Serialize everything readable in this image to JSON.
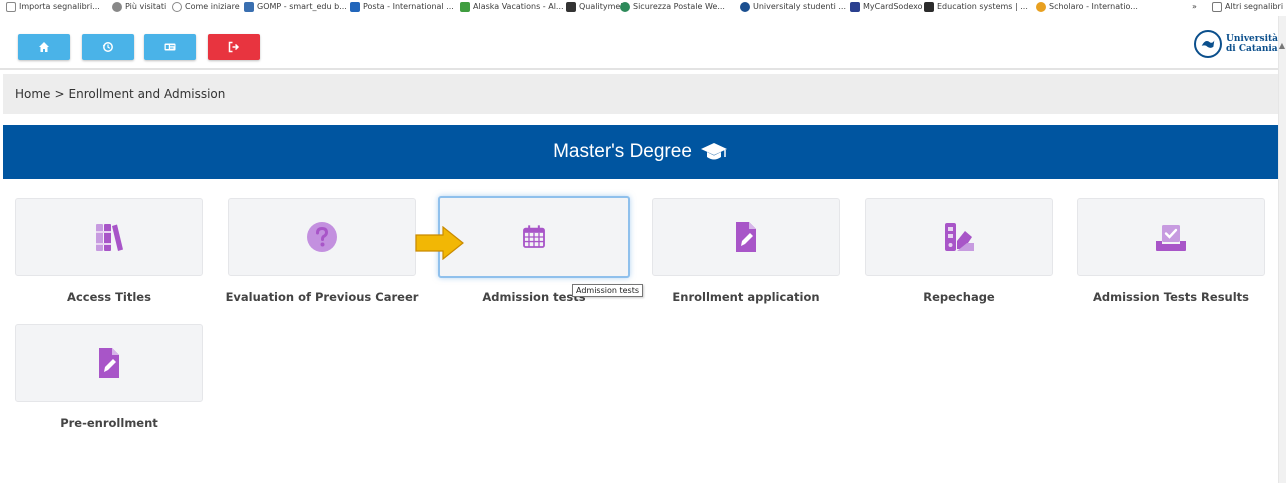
{
  "bookmarks": [
    {
      "label": "Importa segnalibri...",
      "color": "#7a7a7a"
    },
    {
      "label": "Più visitati",
      "color": "#6e6e6e"
    },
    {
      "label": "Come iniziare",
      "color": "#8a8a8a"
    },
    {
      "label": "GOMP - smart_edu b...",
      "color": "#3a6fb0"
    },
    {
      "label": "Posta - International ...",
      "color": "#2266bb"
    },
    {
      "label": "Alaska Vacations - Al...",
      "color": "#3f9d3f"
    },
    {
      "label": "Qualitymei",
      "color": "#333333"
    },
    {
      "label": "Sicurezza Postale We...",
      "color": "#2d8a5a"
    },
    {
      "label": "Universitaly studenti ...",
      "color": "#1a4e8f"
    },
    {
      "label": "MyCardSodexo",
      "color": "#2a3f8f"
    },
    {
      "label": "Education systems | ...",
      "color": "#2b2b2b"
    },
    {
      "label": "Scholaro - Internatio...",
      "color": "#e8a020"
    }
  ],
  "bookmarks_more": "»",
  "bookmarks_other": "Altri segnalibri",
  "toolbar": {
    "buttons": [
      {
        "name": "home-button",
        "icon": "home-icon",
        "color": "#4ab3e8"
      },
      {
        "name": "history-button",
        "icon": "history-icon",
        "color": "#4ab3e8"
      },
      {
        "name": "id-card-button",
        "icon": "id-card-icon",
        "color": "#4ab3e8"
      },
      {
        "name": "logout-button",
        "icon": "logout-icon",
        "color": "#e8343f"
      }
    ],
    "logo_line1": "Università",
    "logo_line2": "di Catania"
  },
  "breadcrumb": {
    "home": "Home",
    "separator": ">",
    "current": "Enrollment and Admission"
  },
  "banner": {
    "title": "Master's Degree",
    "color": "#0055a0"
  },
  "tiles": [
    {
      "label": "Access Titles",
      "icon": "books-icon"
    },
    {
      "label": "Evaluation of Previous Career",
      "icon": "question-circle-icon"
    },
    {
      "label": "Admission tests",
      "icon": "calendar-icon",
      "active": true
    },
    {
      "label": "Enrollment application",
      "icon": "file-signature-icon"
    },
    {
      "label": "Repechage",
      "icon": "swatchbook-icon"
    },
    {
      "label": "Admission Tests Results",
      "icon": "vote-box-icon"
    },
    {
      "label": "Pre-enrollment",
      "icon": "file-signature-icon"
    }
  ],
  "tooltip": "Admission tests",
  "colors": {
    "icon_purple": "#a855c8",
    "arrow": "#f2b705"
  }
}
